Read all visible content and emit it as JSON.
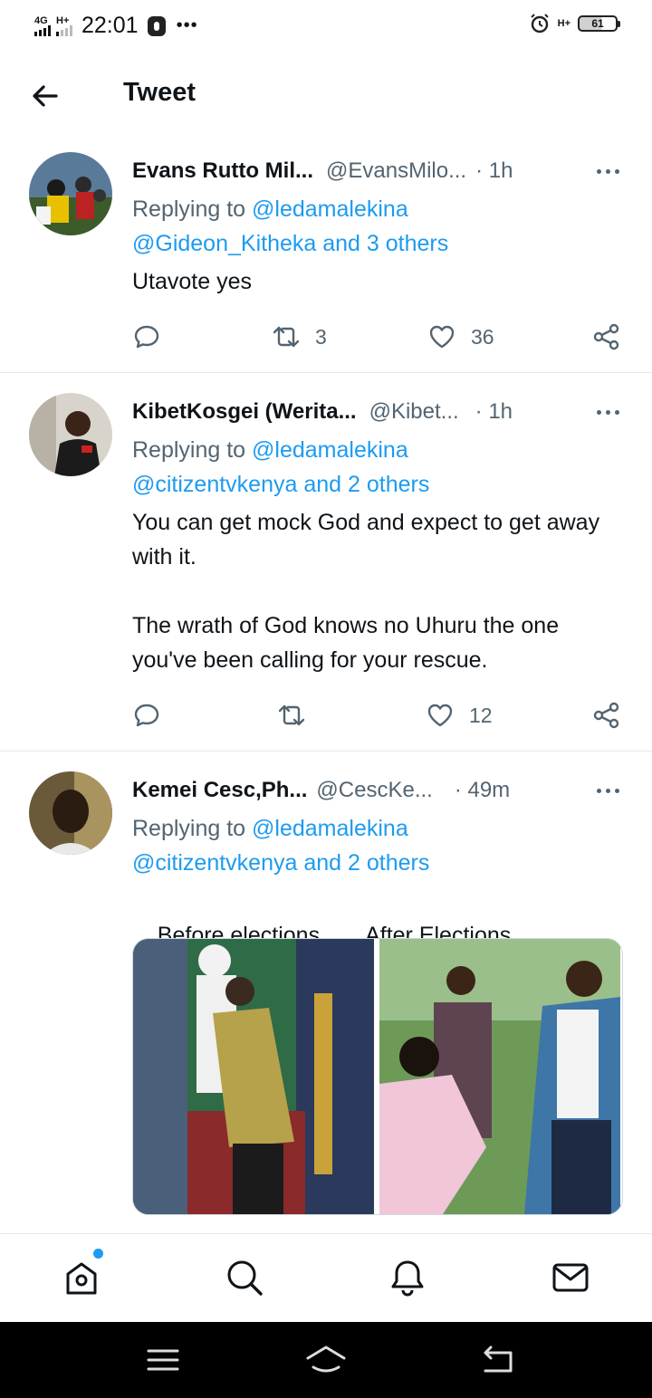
{
  "status_bar": {
    "network": "4G",
    "network2": "H+",
    "time": "22:01",
    "dots": "•••",
    "signal_badge": "H+",
    "battery": "61"
  },
  "header": {
    "title": "Tweet"
  },
  "tweets": [
    {
      "name": "Evans Rutto Mil...",
      "handle": "@EvansMilo...",
      "time": "· 1h",
      "replying_prefix": "Replying to ",
      "replying_first": "@ledamalekina",
      "replying_second": "@Gideon_Kitheka and 3 others",
      "text": "Utavote yes",
      "retweets": "3",
      "likes": "36"
    },
    {
      "name": "KibetKosgei (Werita...",
      "handle": "@Kibet...",
      "time": "· 1h",
      "replying_prefix": "Replying to ",
      "replying_first": "@ledamalekina",
      "replying_second": "@citizentvkenya and 2 others",
      "text": "You can get mock God and expect to get away with it.\n\nThe wrath of God knows no Uhuru the one you've been calling for your rescue.",
      "retweets": "",
      "likes": "12"
    },
    {
      "name": "Kemei Cesc,Ph...",
      "handle": "@CescKe...",
      "time": "· 49m",
      "replying_prefix": "Replying to ",
      "replying_first": "@ledamalekina",
      "replying_second": "@citizentvkenya and 2 others",
      "caption_left": "Before elections",
      "caption_right": "After Elections"
    }
  ],
  "bottom_nav": [
    "home-icon",
    "search-icon",
    "notifications-icon",
    "messages-icon"
  ],
  "system_nav": [
    "menu-icon",
    "home-icon",
    "back-icon"
  ],
  "colors": {
    "link": "#1d9bf0",
    "secondary": "#536471",
    "text": "#0f1419"
  }
}
